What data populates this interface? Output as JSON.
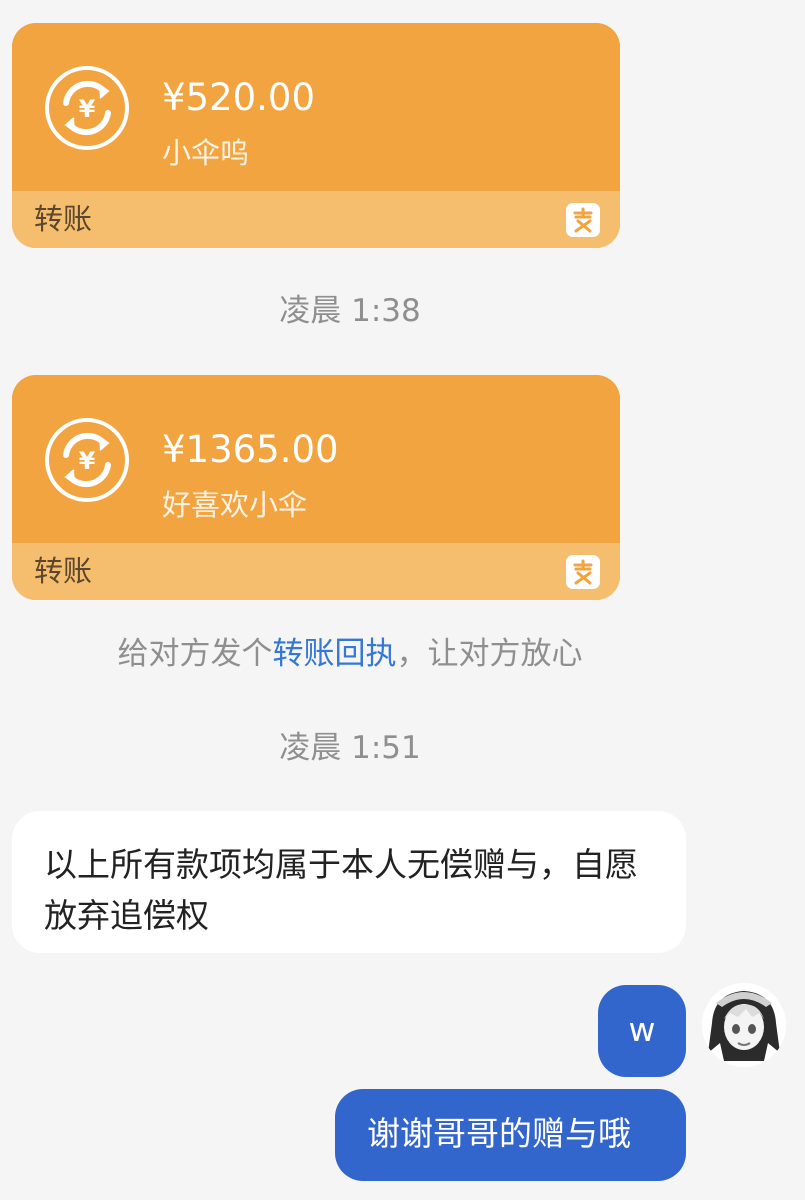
{
  "transfers": [
    {
      "amount": "¥520.00",
      "note": "小伞呜",
      "label": "转账"
    },
    {
      "amount": "¥1365.00",
      "note": "好喜欢小伞",
      "label": "转账"
    }
  ],
  "timestamps": [
    "凌晨 1:38",
    "凌晨 1:51"
  ],
  "system": {
    "prefix": "给对方发个",
    "link": "转账回执",
    "suffix": "，让对方放心"
  },
  "messages": {
    "left_text": "以上所有款项均属于本人无偿赠与，自愿放弃追偿权",
    "right_w": "w",
    "right_thanks": "谢谢哥哥的赠与哦"
  },
  "colors": {
    "card_top": "#f1a440",
    "card_bottom": "#f5be6f",
    "link": "#3477d4",
    "self_bubble": "#3366cc"
  },
  "icons": {
    "transfer": "currency-exchange-icon",
    "alipay": "alipay-logo-icon"
  }
}
